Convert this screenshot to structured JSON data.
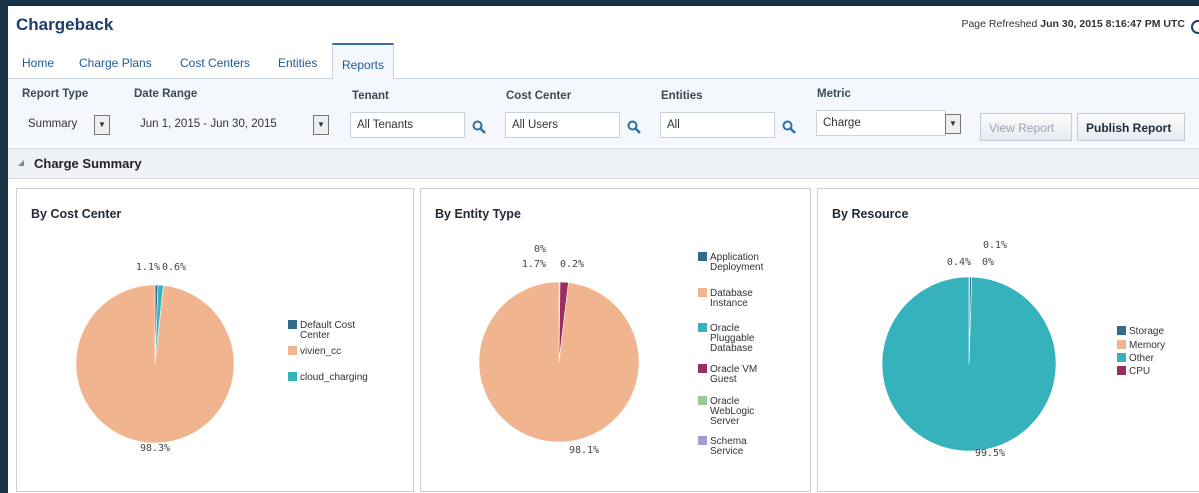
{
  "app": {
    "title": "Chargeback",
    "refresh_label": "Page Refreshed",
    "refresh_time": "Jun 30, 2015 8:16:47 PM UTC"
  },
  "tabs": [
    {
      "label": "Home"
    },
    {
      "label": "Charge Plans"
    },
    {
      "label": "Cost Centers"
    },
    {
      "label": "Entities"
    },
    {
      "label": "Reports",
      "active": true
    }
  ],
  "filters": {
    "report_type": {
      "label": "Report Type",
      "value": "Summary"
    },
    "date_range": {
      "label": "Date Range",
      "value": "Jun 1, 2015 - Jun 30, 2015"
    },
    "tenant": {
      "label": "Tenant",
      "value": "All Tenants"
    },
    "cost_center": {
      "label": "Cost Center",
      "value": "All Users"
    },
    "entities": {
      "label": "Entities",
      "value": "All"
    },
    "metric": {
      "label": "Metric",
      "value": "Charge"
    }
  },
  "buttons": {
    "view_report": "View Report",
    "publish_report": "Publish Report"
  },
  "section": {
    "title": "Charge Summary"
  },
  "chart_data": [
    {
      "type": "pie",
      "title": "By Cost Center",
      "categories": [
        "Default Cost Center",
        "vivien_cc",
        "cloud_charging"
      ],
      "values": [
        0.6,
        98.3,
        1.1
      ],
      "colors": [
        "#336b8c",
        "#f0b48e",
        "#35b2bc"
      ],
      "labels": [
        "0.6%",
        "98.3%",
        "1.1%"
      ],
      "legend": "right"
    },
    {
      "type": "pie",
      "title": "By Entity Type",
      "categories": [
        "Application Deployment",
        "Database Instance",
        "Oracle Pluggable Database",
        "Oracle VM Guest",
        "Oracle WebLogic Server",
        "Schema Service"
      ],
      "values": [
        0,
        98.1,
        0.2,
        1.7,
        0,
        0
      ],
      "colors": [
        "#336b8c",
        "#f0b48e",
        "#35b2bc",
        "#9a2e62",
        "#9cc79a",
        "#a99ad0"
      ],
      "labels": [
        "0%",
        "98.1%",
        "0.2%",
        "1.7%",
        "",
        ""
      ],
      "legend": "right"
    },
    {
      "type": "pie",
      "title": "By Resource",
      "categories": [
        "Storage",
        "Memory",
        "Other",
        "CPU"
      ],
      "values": [
        0.4,
        0,
        99.5,
        0.1
      ],
      "colors": [
        "#336b8c",
        "#f0b48e",
        "#35b2bc",
        "#9a2e62"
      ],
      "labels": [
        "0.4%",
        "0%",
        "99.5%",
        "0.1%"
      ],
      "legend": "right"
    }
  ]
}
